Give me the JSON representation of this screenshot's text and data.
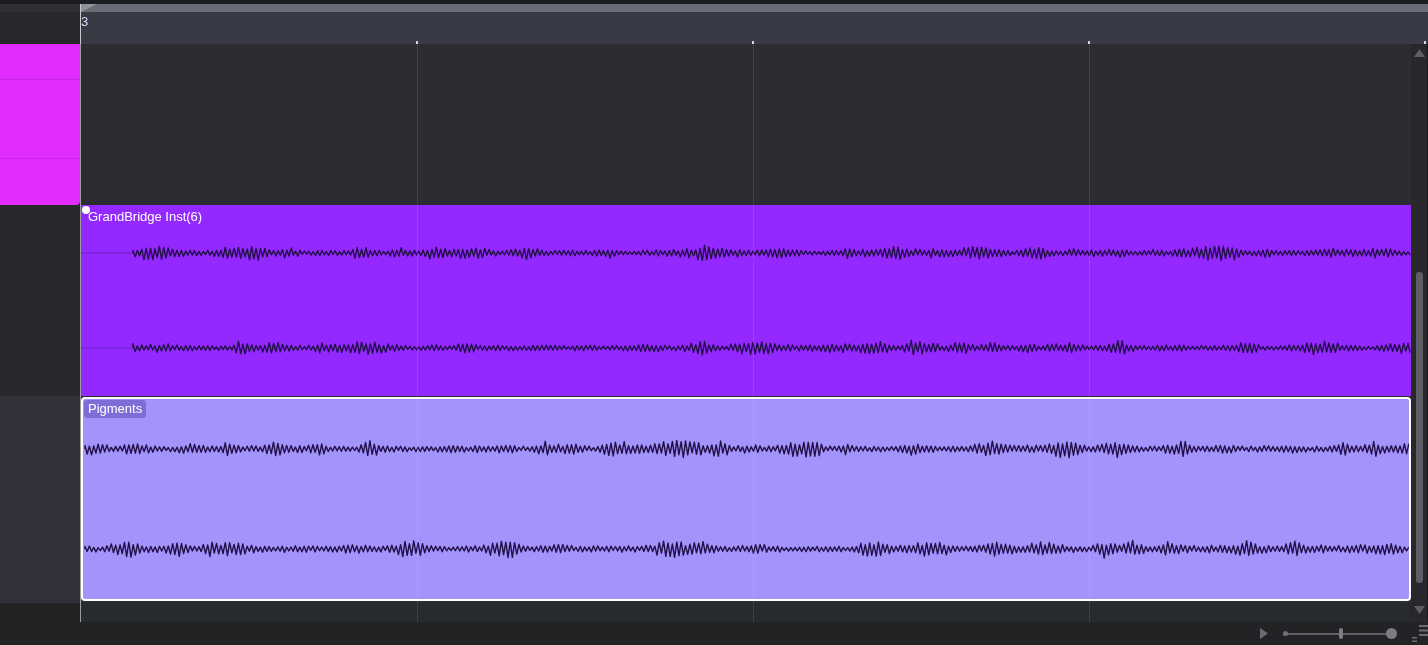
{
  "ruler": {
    "bar_label": "3"
  },
  "tracks": [
    {
      "clip": {
        "color": "#e22bff"
      }
    },
    {
      "region": {
        "label": "GrandBridge Inst(6)",
        "color": "#9429ff",
        "selected": false,
        "fade_handle": true
      }
    },
    {
      "region": {
        "label": "Pigments",
        "color": "#a294fb",
        "selected": true
      }
    }
  ],
  "zoom_slider": {
    "level": 0.51
  }
}
